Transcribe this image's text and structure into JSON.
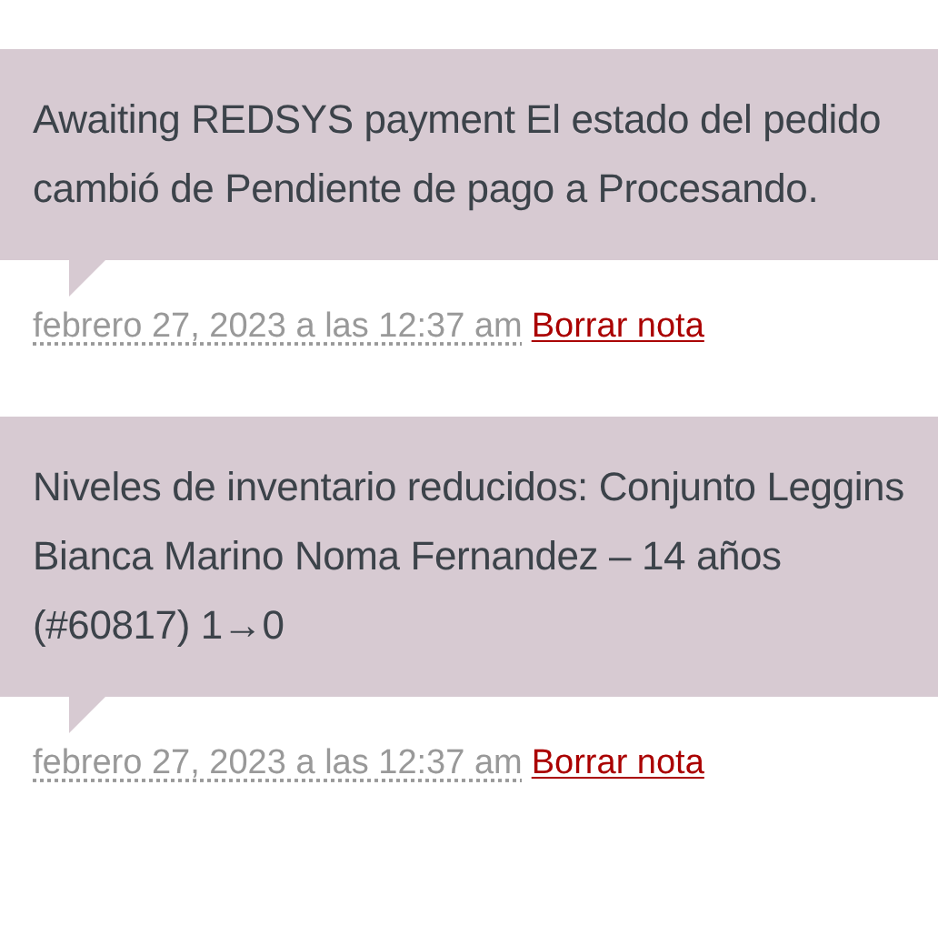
{
  "notes": [
    {
      "text": "Awaiting REDSYS payment El estado del pedido cambió de Pendiente de pago a Procesando.",
      "date": "febrero 27, 2023 a las 12:37 am",
      "delete_label": "Borrar nota"
    },
    {
      "text": "Niveles de inventario reducidos: Conjunto Leggins Bianca Marino Noma Fernandez – 14 años (#60817) 1→0",
      "date": "febrero 27, 2023 a las 12:37 am",
      "delete_label": "Borrar nota"
    }
  ]
}
